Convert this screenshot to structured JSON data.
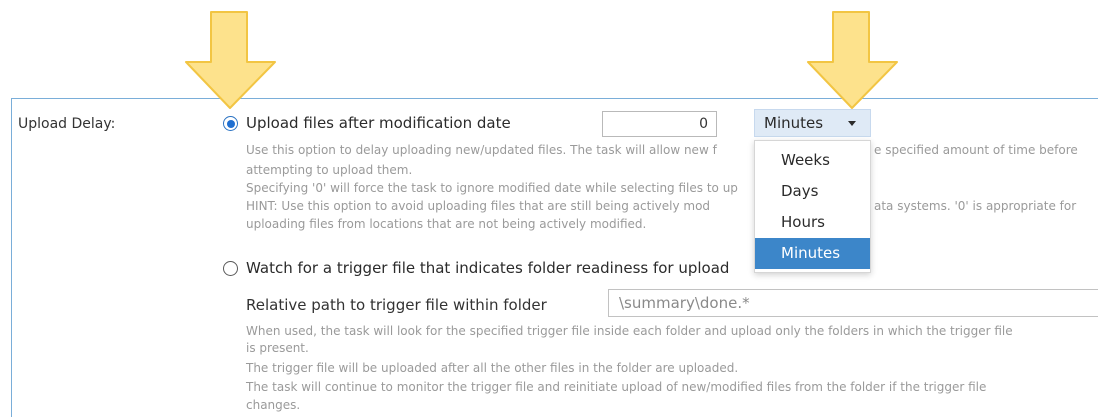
{
  "field_label": "Upload Delay:",
  "option_modification": {
    "label": "Upload files after modification date",
    "delay_value": "0",
    "unit_selected": "Minutes",
    "help_lines": [
      "Use this option to delay uploading new/updated files. The task will allow new f",
      "e specified amount of time before",
      "attempting to upload them.",
      "Specifying '0' will force the task to ignore modified date while selecting files to up",
      "HINT: Use this option to avoid uploading files that are still being actively mod",
      "ata systems. '0' is appropriate for",
      "uploading files from locations that are not being actively modified."
    ]
  },
  "unit_menu": {
    "options": [
      "Weeks",
      "Days",
      "Hours",
      "Minutes"
    ]
  },
  "option_trigger": {
    "label": "Watch for a trigger file that indicates folder readiness for upload",
    "path_label": "Relative path to trigger file within folder",
    "path_value": "\\summary\\done.*",
    "help_lines": [
      "When used, the task will look for the specified trigger file inside each folder and upload only the folders in which the trigger file",
      "is present.",
      "The trigger file will be uploaded after all the other files in the folder are uploaded.",
      "The task will continue to monitor the trigger file and reinitiate upload of new/modified files from the folder if the trigger file",
      "changes."
    ]
  },
  "colors": {
    "accent": "#1f6fd1",
    "menu_selected": "#3c86c9",
    "arrow_fill": "#fde28c",
    "arrow_stroke": "#f2c543"
  }
}
